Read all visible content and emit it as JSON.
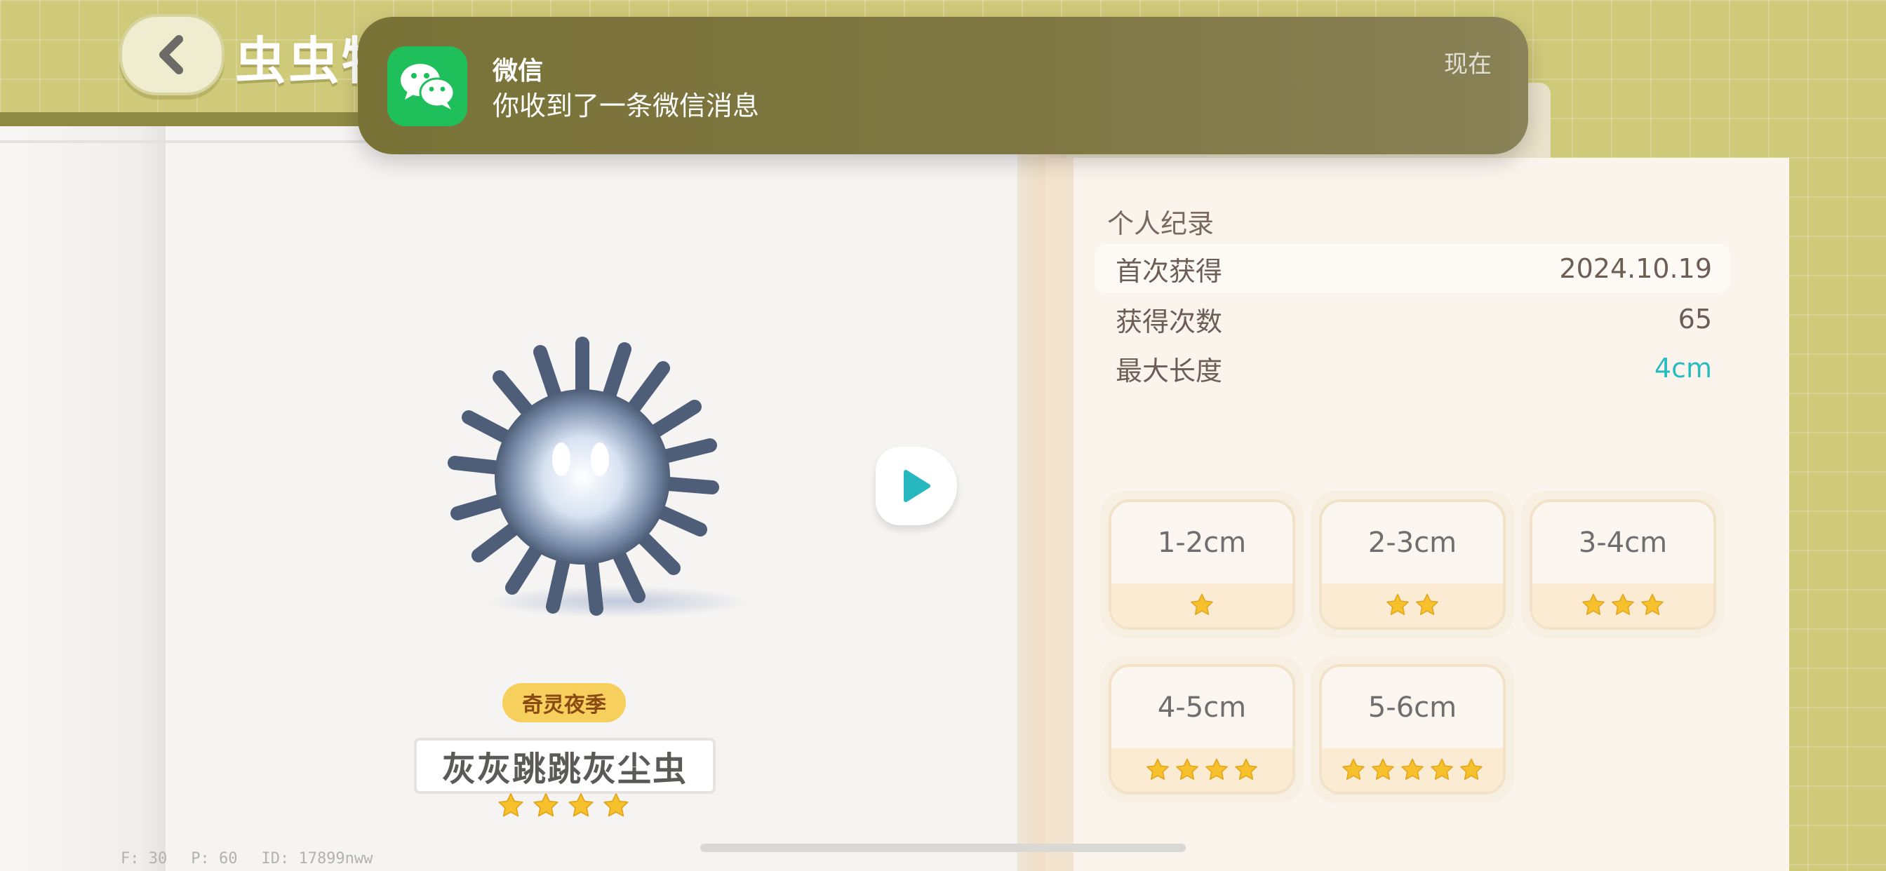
{
  "header": {
    "title": "虫虫物"
  },
  "creature": {
    "season_badge": "奇灵夜季",
    "name": "灰灰跳跳灰尘虫",
    "rarity_stars": 4
  },
  "records": {
    "title": "个人纪录",
    "rows": [
      {
        "label": "首次获得",
        "value": "2024.10.19"
      },
      {
        "label": "获得次数",
        "value": "65"
      },
      {
        "label": "最大长度",
        "value": "4cm"
      }
    ]
  },
  "size_tiers": [
    {
      "label": "1-2cm",
      "stars": 1
    },
    {
      "label": "2-3cm",
      "stars": 2
    },
    {
      "label": "3-4cm",
      "stars": 3
    },
    {
      "label": "4-5cm",
      "stars": 4
    },
    {
      "label": "5-6cm",
      "stars": 5
    }
  ],
  "notification": {
    "app": "微信",
    "message": "你收到了一条微信消息",
    "time": "现在"
  },
  "debug": {
    "fps": "F: 30",
    "ping": "P: 60",
    "id": "ID: 17899nww"
  },
  "colors": {
    "accent": "#28bcc1",
    "star": "#f6c12d",
    "wechat": "#1fc05c",
    "badge": "#f7cf5c"
  },
  "icons": {
    "back": "chevron-left-icon",
    "play": "play-icon",
    "star": "star-icon",
    "wechat": "wechat-icon"
  }
}
